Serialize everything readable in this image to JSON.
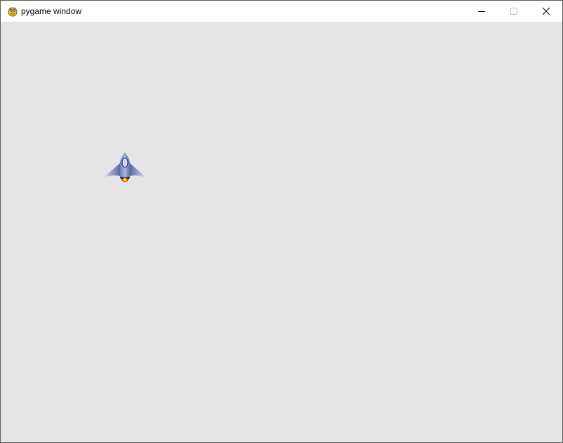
{
  "window": {
    "title": "pygame window",
    "app_icon": "pygame-snake-icon"
  },
  "titlebar_buttons": {
    "minimize_icon": "minimize-icon",
    "maximize_icon": "maximize-icon",
    "close_icon": "close-icon"
  },
  "game": {
    "background_color": "#e5e5e5",
    "sprites": [
      {
        "name": "spaceship",
        "icon": "rocket-ship-sprite"
      }
    ]
  }
}
